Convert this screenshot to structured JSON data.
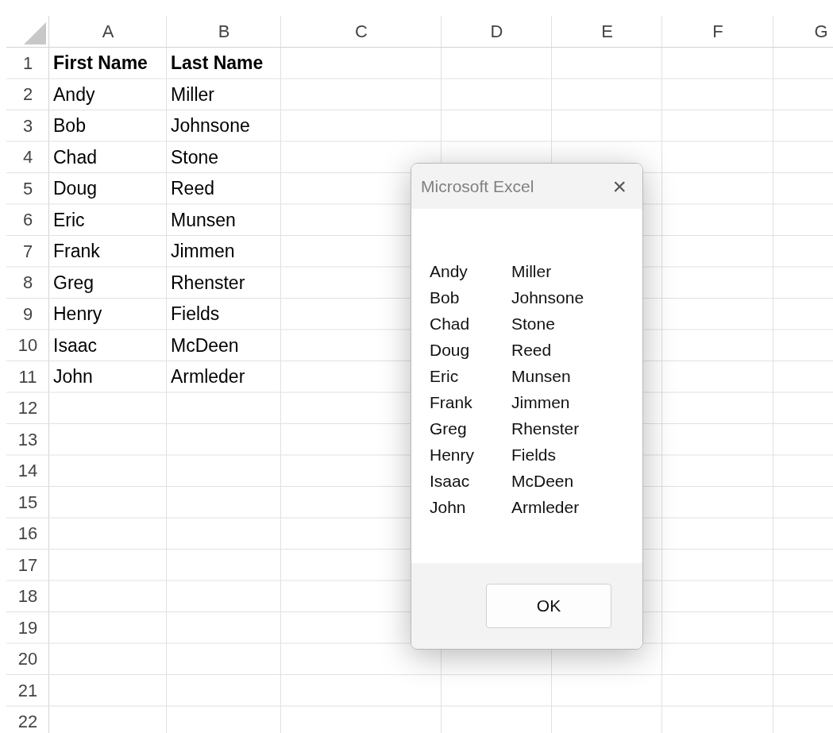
{
  "sheet": {
    "columns": [
      "A",
      "B",
      "C",
      "D",
      "E",
      "F",
      "G"
    ],
    "row_numbers": [
      "1",
      "2",
      "3",
      "4",
      "5",
      "6",
      "7",
      "8",
      "9",
      "10",
      "11",
      "12",
      "13",
      "14",
      "15",
      "16",
      "17",
      "18",
      "19",
      "20",
      "21",
      "22"
    ],
    "header_row": [
      "First Name",
      "Last Name"
    ],
    "rows": [
      [
        "Andy",
        "Miller"
      ],
      [
        "Bob",
        "Johnsone"
      ],
      [
        "Chad",
        "Stone"
      ],
      [
        "Doug",
        "Reed"
      ],
      [
        "Eric",
        "Munsen"
      ],
      [
        "Frank",
        "Jimmen"
      ],
      [
        "Greg",
        "Rhenster"
      ],
      [
        "Henry",
        "Fields"
      ],
      [
        "Isaac",
        "McDeen"
      ],
      [
        "John",
        "Armleder"
      ]
    ]
  },
  "dialog": {
    "title": "Microsoft Excel",
    "close": "×",
    "message_lines": [
      [
        "Andy",
        "Miller"
      ],
      [
        "Bob",
        "Johnsone"
      ],
      [
        "Chad",
        "Stone"
      ],
      [
        "Doug",
        "Reed"
      ],
      [
        "Eric",
        "Munsen"
      ],
      [
        "Frank",
        "Jimmen"
      ],
      [
        "Greg",
        "Rhenster"
      ],
      [
        "Henry",
        "Fields"
      ],
      [
        "Isaac",
        "McDeen"
      ],
      [
        "John",
        "Armleder"
      ]
    ],
    "buttons": [
      "OK"
    ]
  }
}
